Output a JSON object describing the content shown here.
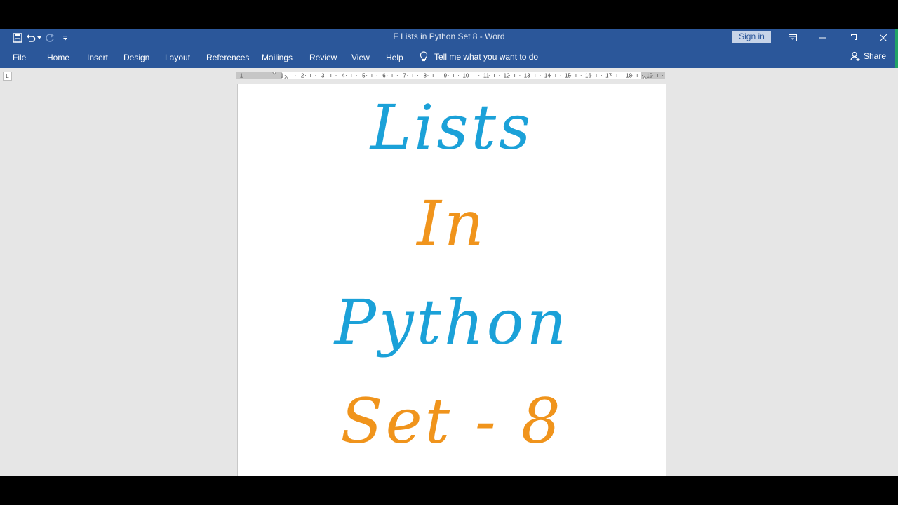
{
  "window": {
    "title": "F Lists in Python Set 8  -  Word",
    "sign_in_label": "Sign in",
    "accent_color": "#2b579a"
  },
  "quick_access": {
    "icons": [
      "save-icon",
      "undo-icon",
      "undo-dropdown-icon",
      "redo-icon",
      "customize-qat-icon"
    ]
  },
  "ribbon": {
    "tabs": [
      "File",
      "Home",
      "Insert",
      "Design",
      "Layout",
      "References",
      "Mailings",
      "Review",
      "View",
      "Help"
    ],
    "tell_me": "Tell me what you want to do",
    "share": "Share"
  },
  "ruler": {
    "numbers": [
      "1",
      "1",
      "2",
      "3",
      "4",
      "5",
      "6",
      "7",
      "8",
      "9",
      "10",
      "11",
      "12",
      "13",
      "14",
      "15",
      "16",
      "17",
      "18",
      "19"
    ],
    "tab_selector": "L"
  },
  "document": {
    "lines": [
      {
        "text": "Lists",
        "color": "#1ba1d8"
      },
      {
        "text": "In",
        "color": "#f0941c"
      },
      {
        "text": "Python",
        "color": "#1ba1d8"
      },
      {
        "text": "Set - 8",
        "color": "#f0941c"
      }
    ]
  }
}
